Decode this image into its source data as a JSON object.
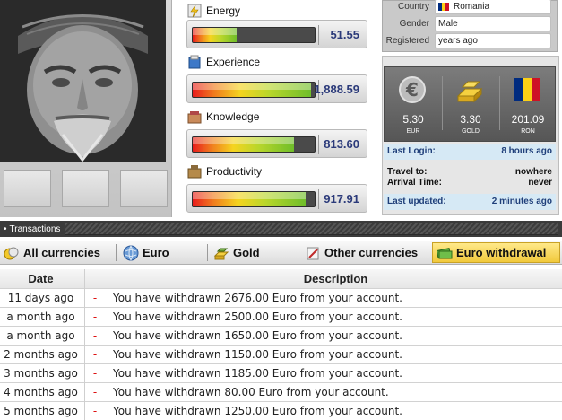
{
  "stats": [
    {
      "label": "Energy",
      "icon": "energy-icon",
      "value": "51.55",
      "fill": 0.36
    },
    {
      "label": "Experience",
      "icon": "experience-icon",
      "value": "1,888.59",
      "fill": 0.97
    },
    {
      "label": "Knowledge",
      "icon": "knowledge-icon",
      "value": "813.60",
      "fill": 0.83
    },
    {
      "label": "Productivity",
      "icon": "productivity-icon",
      "value": "917.91",
      "fill": 0.93
    }
  ],
  "profile": {
    "country_label": "Country",
    "country_value": "Romania",
    "gender_label": "Gender",
    "gender_value": "Male",
    "registered_label": "Registered",
    "registered_value": "years ago"
  },
  "currencies": [
    {
      "amount": "5.30",
      "code": "EUR",
      "icon": "euro-icon"
    },
    {
      "amount": "3.30",
      "code": "GOLD",
      "icon": "gold-icon"
    },
    {
      "amount": "201.09",
      "code": "RON",
      "icon": "romania-flag-icon"
    }
  ],
  "status": {
    "last_login_label": "Last Login:",
    "last_login_value": "8 hours ago",
    "travel_to_label": "Travel to:",
    "travel_to_value": "nowhere",
    "arrival_label": "Arrival Time:",
    "arrival_value": "never",
    "last_updated_label": "Last updated:",
    "last_updated_value": "2 minutes ago"
  },
  "transactions": {
    "title": "Transactions",
    "tabs": [
      {
        "label": "All currencies",
        "icon": "coins-icon",
        "active": false
      },
      {
        "label": "Euro",
        "icon": "globe-icon",
        "active": false
      },
      {
        "label": "Gold",
        "icon": "gold-icon",
        "active": false
      },
      {
        "label": "Other currencies",
        "icon": "pen-icon",
        "active": false
      },
      {
        "label": "Euro withdrawal",
        "icon": "money-icon",
        "active": true
      }
    ],
    "columns": {
      "date": "Date",
      "description": "Description"
    },
    "rows": [
      {
        "date": "11 days ago",
        "mark": "-",
        "description": "You have withdrawn 2676.00 Euro from your account."
      },
      {
        "date": "a month ago",
        "mark": "-",
        "description": "You have withdrawn 2500.00 Euro from your account."
      },
      {
        "date": "a month ago",
        "mark": "-",
        "description": "You have withdrawn 1650.00 Euro from your account."
      },
      {
        "date": "2 months ago",
        "mark": "-",
        "description": "You have withdrawn 1150.00 Euro from your account."
      },
      {
        "date": "3 months ago",
        "mark": "-",
        "description": "You have withdrawn 1185.00 Euro from your account."
      },
      {
        "date": "4 months ago",
        "mark": "-",
        "description": "You have withdrawn 80.00 Euro from your account."
      },
      {
        "date": "5 months ago",
        "mark": "-",
        "description": "You have withdrawn 1250.00 Euro from your account."
      }
    ]
  },
  "colors": {
    "accent_blue": "#2b3a7a",
    "active_tab": "#f1c93c",
    "negative": "#dd1111",
    "info_blue_bg": "#d6e9f5"
  }
}
